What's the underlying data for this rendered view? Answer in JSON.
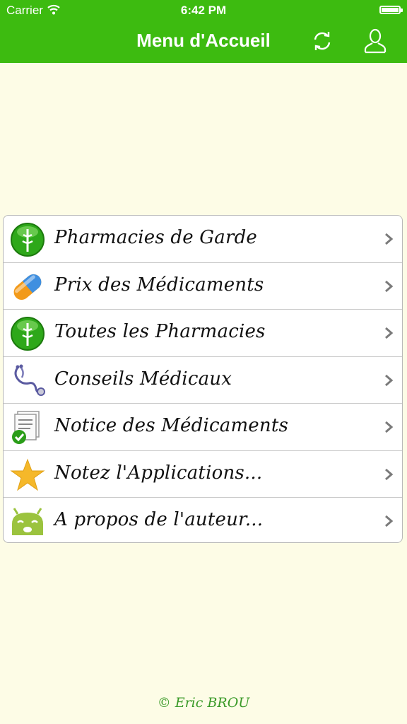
{
  "status_bar": {
    "carrier": "Carrier",
    "time": "6:42 PM"
  },
  "nav": {
    "title": "Menu d'Accueil",
    "refresh_icon": "refresh-icon",
    "user_icon": "user-icon",
    "bar_color": "#3dbb10"
  },
  "menu": {
    "items": [
      {
        "label": "Pharmacies de Garde",
        "icon": "pharmacy-icon"
      },
      {
        "label": "Prix des Médicaments",
        "icon": "pill-icon"
      },
      {
        "label": "Toutes les Pharmacies",
        "icon": "pharmacy-icon"
      },
      {
        "label": "Conseils Médicaux",
        "icon": "stethoscope-icon"
      },
      {
        "label": "Notice des Médicaments",
        "icon": "document-check-icon"
      },
      {
        "label": "Notez l'Applications...",
        "icon": "star-icon"
      },
      {
        "label": "A propos de l'auteur...",
        "icon": "android-icon"
      }
    ]
  },
  "footer": {
    "text": "© Eric BROU"
  }
}
